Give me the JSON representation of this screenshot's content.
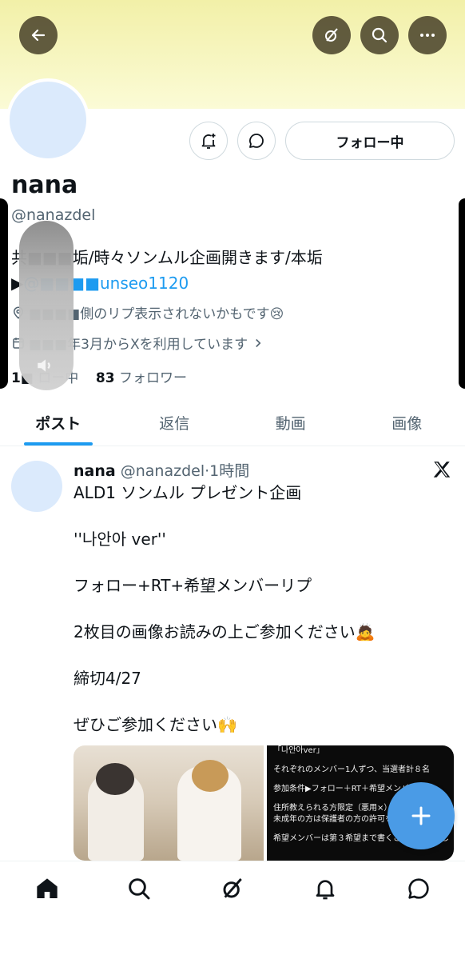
{
  "profile": {
    "display_name": "nana",
    "handle": "@nanazdel",
    "bio_line1": "共■■■垢/時々ソンムル企画開きます/本垢",
    "bio_line2_prefix": "▶",
    "bio_link": "@■■■■unseo1120",
    "note": "■■■■側のリプ表示されないかもです😢",
    "joined": "■■■年3月からXを利用しています",
    "following_count": "1■",
    "following_label": "ロー中",
    "followers_count": "83",
    "followers_label": "フォロワー"
  },
  "actions": {
    "follow_label": "フォロー中"
  },
  "tabs": [
    "ポスト",
    "返信",
    "動画",
    "画像"
  ],
  "post": {
    "author_name": "nana",
    "author_handle": "@nanazdel",
    "separator": "·",
    "time": "1時間",
    "lines": [
      "ALD1 ソンムル プレゼント企画",
      "''나안아 ver''",
      "フォロー+RT+希望メンバーリプ",
      "2枚目の画像お読みの上ご参加ください🙇",
      "締切4/27",
      "ぜひご参加ください🙌"
    ],
    "media_text": [
      "「나안아ver」",
      "それぞれのメンバー1人ずつ、当選者計８名",
      "参加条件▶フォロー＋RT＋希望メンバー",
      "住所教えられる方限定（悪用×）",
      "未成年の方は保護者の方の許可をお",
      "希望メンバーは第３希望まで書くことおすすめし"
    ]
  },
  "icons": {
    "top": [
      "back-arrow-icon",
      "grok-icon",
      "search-icon",
      "more-icon"
    ],
    "nav": [
      "home-icon",
      "search-icon",
      "grok-icon",
      "notifications-icon",
      "messages-icon"
    ]
  },
  "colors": {
    "accent": "#1d9bf0",
    "banner": "#f2f0a8",
    "fab": "#4a9be6"
  }
}
